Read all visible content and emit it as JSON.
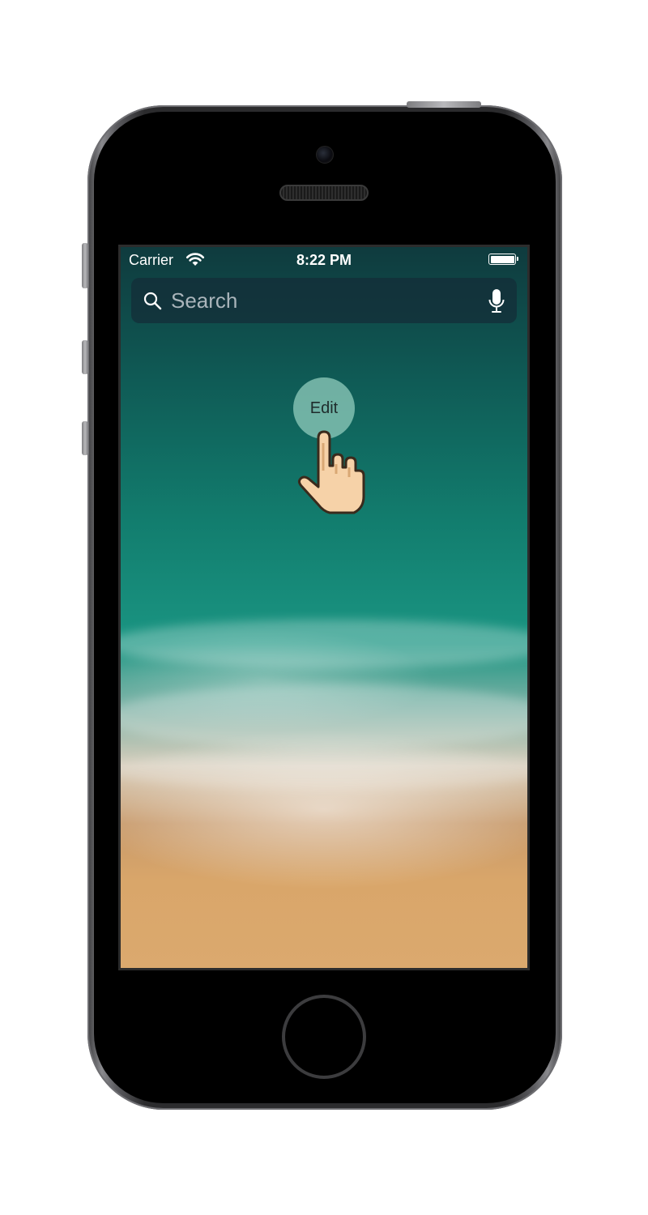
{
  "status_bar": {
    "carrier": "Carrier",
    "time": "8:22 PM",
    "wifi_icon": "wifi-icon",
    "battery_icon": "battery-icon"
  },
  "search": {
    "placeholder": "Search",
    "icon": "search-icon",
    "mic_icon": "microphone-icon"
  },
  "gesture": {
    "label": "Edit",
    "pointer_icon": "hand-pointer-icon"
  },
  "device": {
    "home_button_icon": "home-button"
  },
  "colors": {
    "screen_text": "#ffffff",
    "search_bg": "#142d37",
    "touch_bubble": "#8cc8b9"
  }
}
